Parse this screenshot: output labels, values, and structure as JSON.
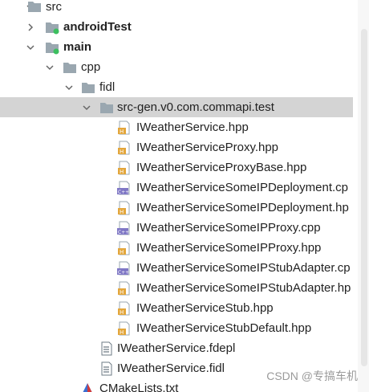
{
  "tree": {
    "items": [
      {
        "label": "src",
        "icon": "folder-icon",
        "expanded": true
      },
      {
        "label": "androidTest",
        "icon": "test-folder-icon",
        "expanded": false
      },
      {
        "label": "main",
        "icon": "source-folder-icon",
        "expanded": true
      },
      {
        "label": "cpp",
        "icon": "folder-icon",
        "expanded": true
      },
      {
        "label": "fidl",
        "icon": "folder-icon",
        "expanded": true
      },
      {
        "label": "src-gen.v0.com.commapi.test",
        "icon": "folder-icon",
        "expanded": true,
        "selected": true
      },
      {
        "label": "IWeatherService.hpp",
        "icon": "hpp-file-icon"
      },
      {
        "label": "IWeatherServiceProxy.hpp",
        "icon": "hpp-file-icon"
      },
      {
        "label": "IWeatherServiceProxyBase.hpp",
        "icon": "hpp-file-icon"
      },
      {
        "label": "IWeatherServiceSomeIPDeployment.cp",
        "icon": "cpp-file-icon"
      },
      {
        "label": "IWeatherServiceSomeIPDeployment.hp",
        "icon": "hpp-file-icon"
      },
      {
        "label": "IWeatherServiceSomeIPProxy.cpp",
        "icon": "cpp-file-icon"
      },
      {
        "label": "IWeatherServiceSomeIPProxy.hpp",
        "icon": "hpp-file-icon"
      },
      {
        "label": "IWeatherServiceSomeIPStubAdapter.cp",
        "icon": "cpp-file-icon"
      },
      {
        "label": "IWeatherServiceSomeIPStubAdapter.hp",
        "icon": "hpp-file-icon"
      },
      {
        "label": "IWeatherServiceStub.hpp",
        "icon": "hpp-file-icon"
      },
      {
        "label": "IWeatherServiceStubDefault.hpp",
        "icon": "hpp-file-icon"
      },
      {
        "label": "IWeatherService.fdepl",
        "icon": "text-file-icon"
      },
      {
        "label": "IWeatherService.fidl",
        "icon": "text-file-icon"
      },
      {
        "label": "CMakeLists.txt",
        "icon": "cmake-icon"
      }
    ]
  },
  "watermark": "CSDN @专搞车机",
  "colors": {
    "folder": "#9aa7b0",
    "hpp_badge": "#e3a63b",
    "cpp_badge": "#7f77c5",
    "test_dot": "#3cbf5f",
    "selection": "#d4d4d4",
    "cmake": "#3d6fd1"
  }
}
